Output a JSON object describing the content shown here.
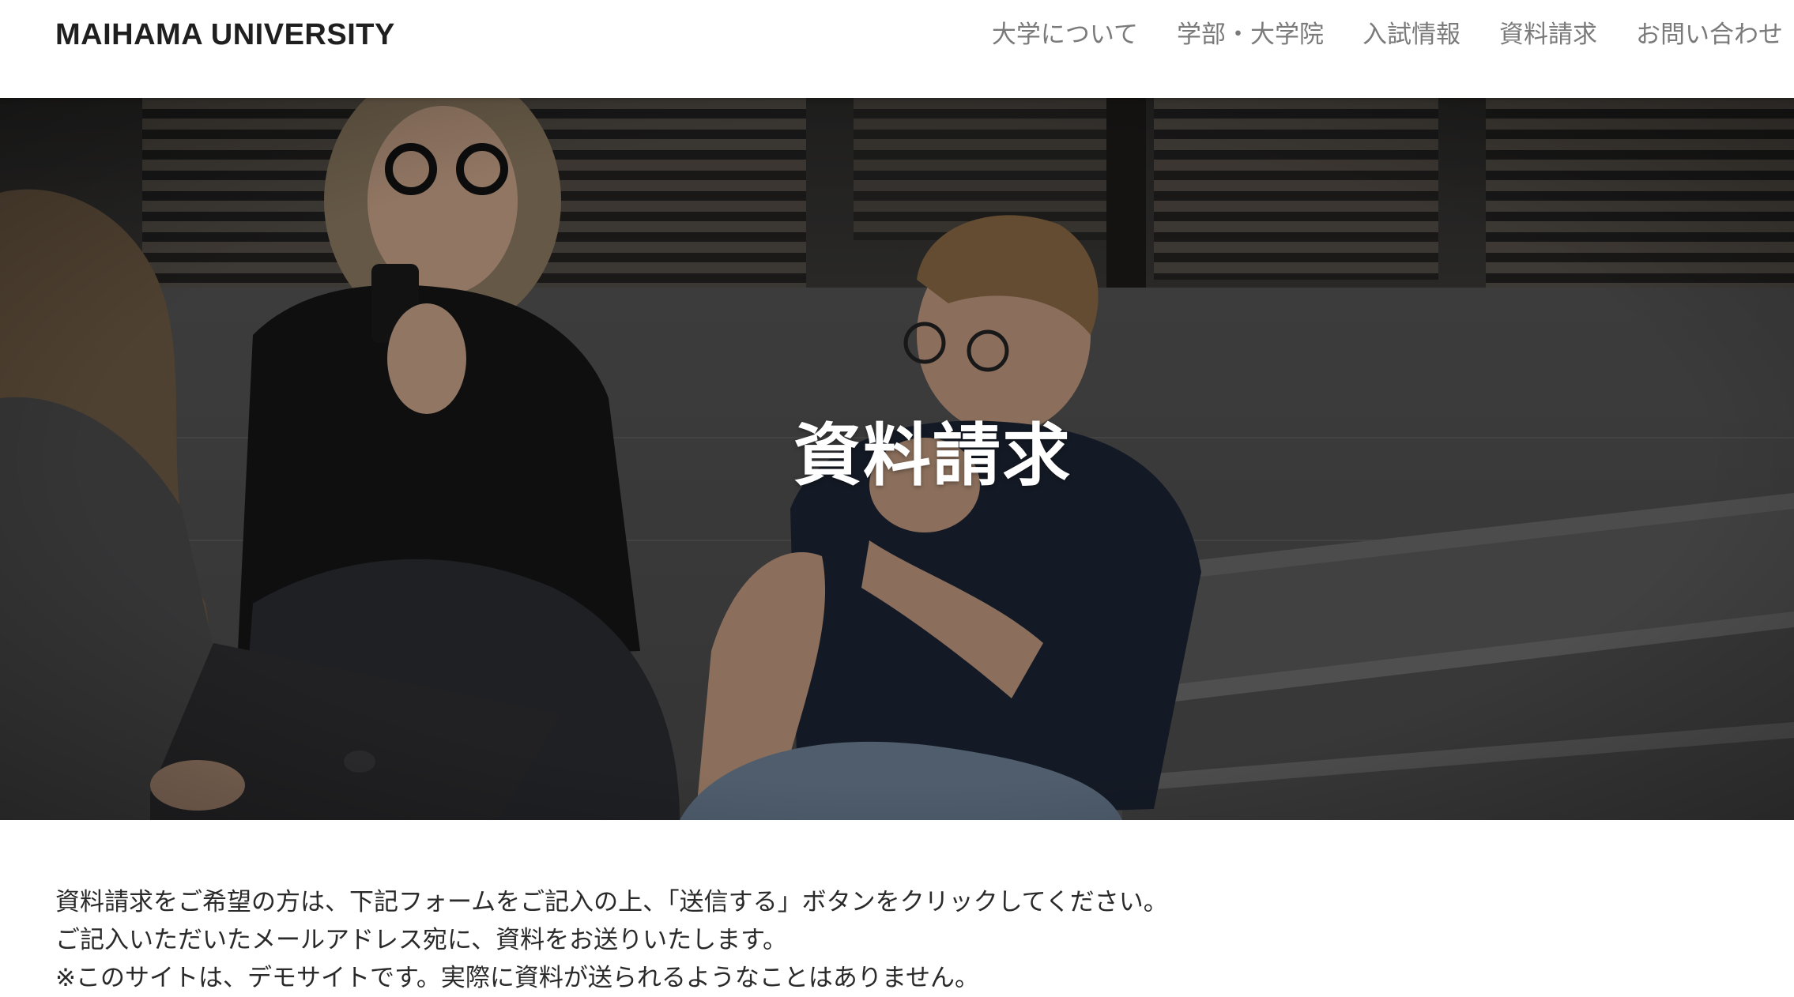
{
  "header": {
    "logo": "MAIHAMA UNIVERSITY",
    "nav": [
      {
        "label": "大学について"
      },
      {
        "label": "学部・大学院"
      },
      {
        "label": "入試情報"
      },
      {
        "label": "資料請求"
      },
      {
        "label": "お問い合わせ"
      }
    ]
  },
  "hero": {
    "title": "資料請求"
  },
  "intro": {
    "lines": [
      "資料請求をご希望の方は、下記フォームをご記入の上、「送信する」ボタンをクリックしてください。",
      "ご記入いただいたメールアドレス宛に、資料をお送りいたします。",
      "※このサイトは、デモサイトです。実際に資料が送られるようなことはありません。"
    ]
  },
  "colors": {
    "header_bg": "#ffffff",
    "logo": "#1f1f1f",
    "nav_text": "#7a7a7a",
    "hero_title": "#ffffff",
    "body_text": "#2a2a2a"
  }
}
